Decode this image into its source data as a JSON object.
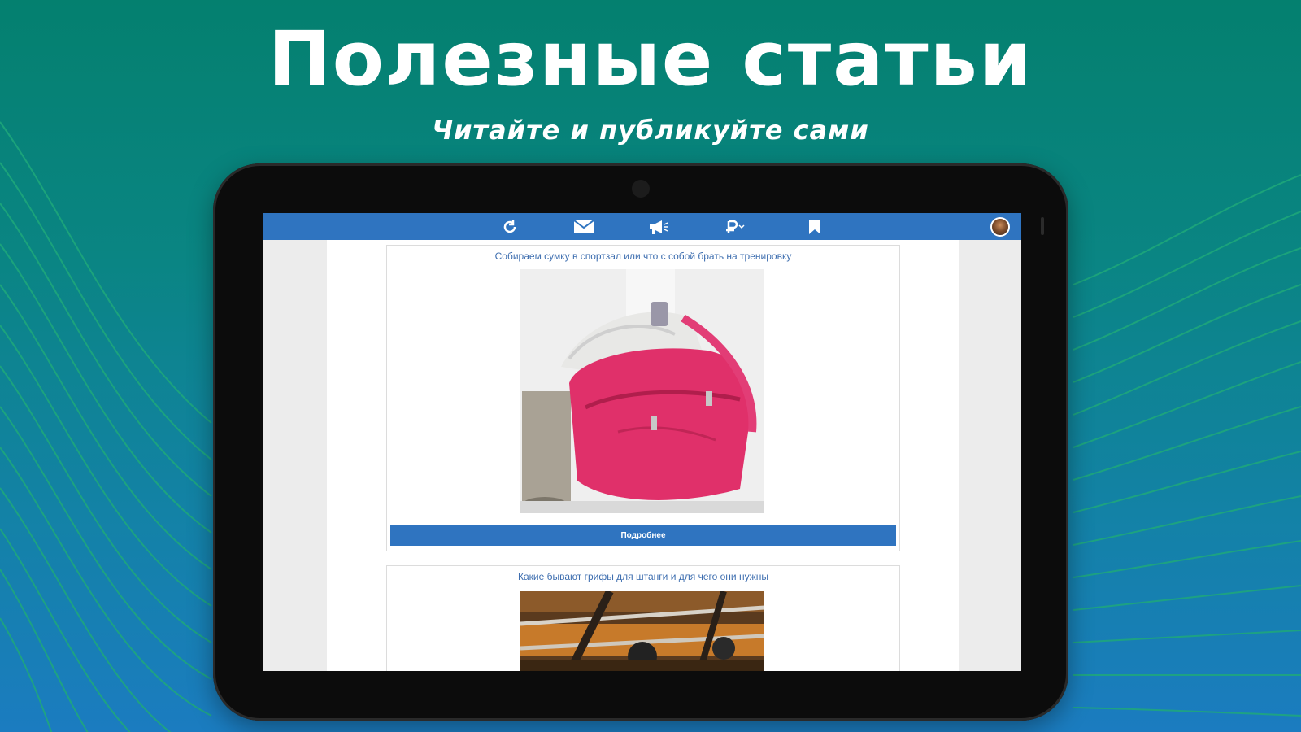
{
  "promo": {
    "headline": "Полезные статьи",
    "subheadline": "Читайте и публикуйте сами"
  },
  "app": {
    "toolbar": {
      "icons": [
        "refresh-icon",
        "mail-icon",
        "megaphone-icon",
        "ruble-icon",
        "bookmark-icon"
      ],
      "accent_color": "#2f74c0"
    },
    "articles": [
      {
        "title": "Собираем сумку в спортзал или что с собой брать на тренировку",
        "image": "pink-gym-bag-photo",
        "button_label": "Подробнее"
      },
      {
        "title": "Какие бывают грифы для штанги и для чего они нужны",
        "image": "gym-barbells-photo"
      }
    ]
  }
}
